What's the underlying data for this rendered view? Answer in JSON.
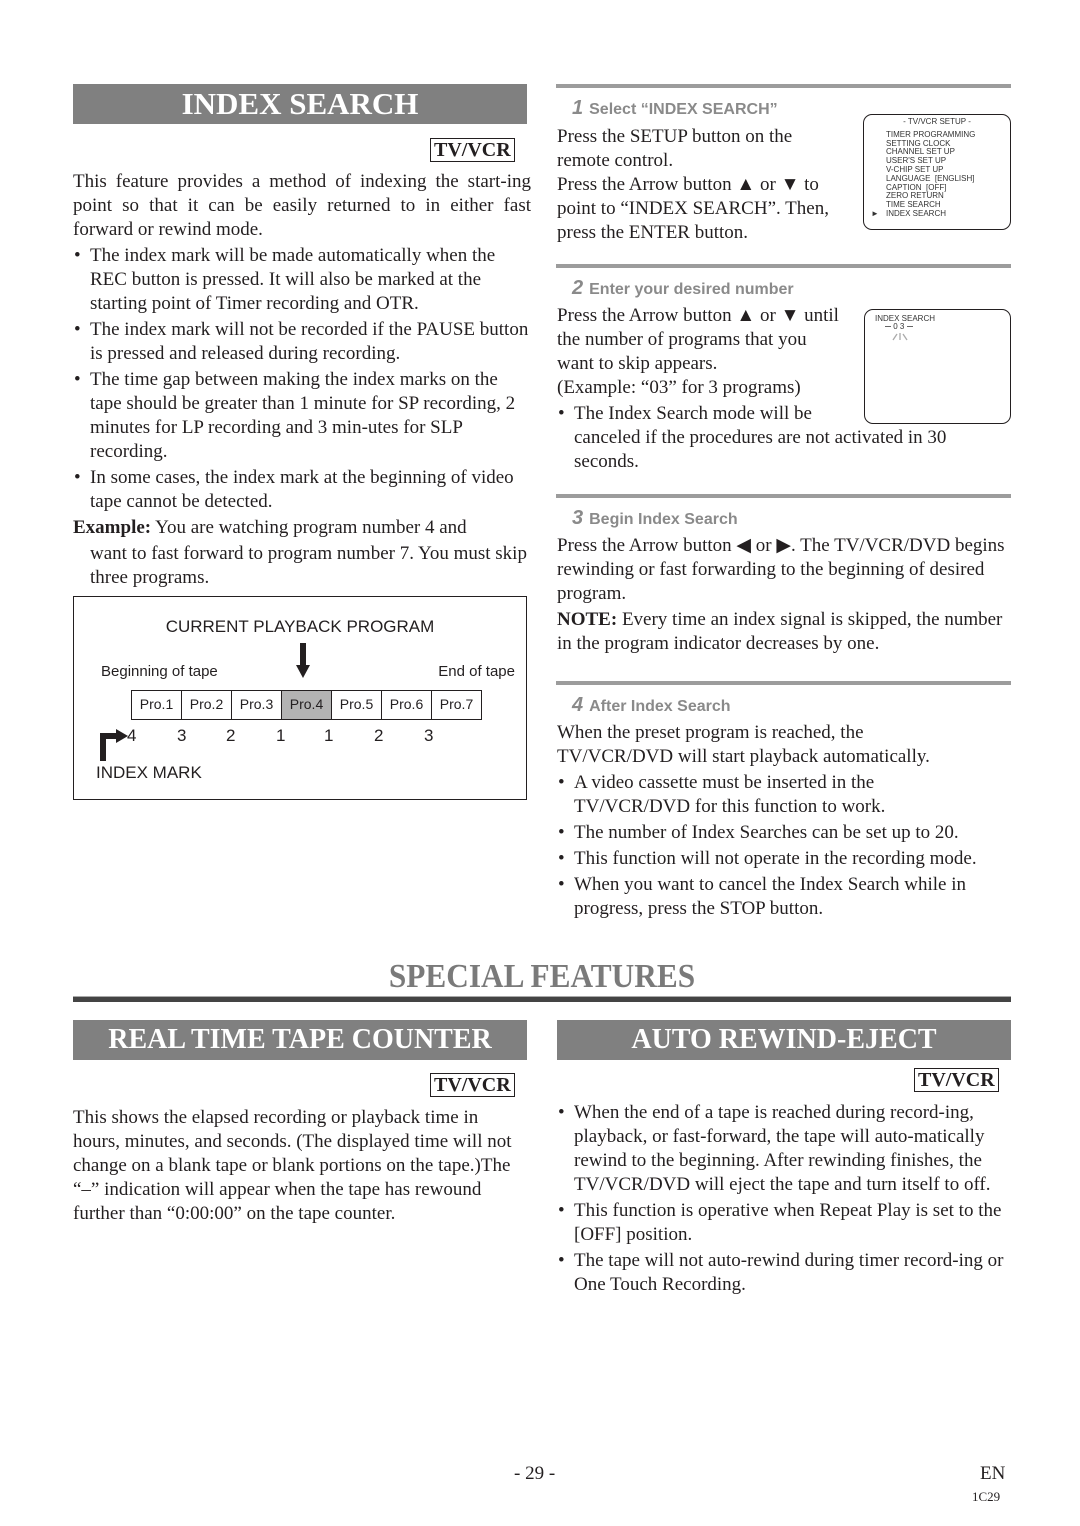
{
  "index_search": {
    "title": "INDEX SEARCH",
    "badge": "TV/VCR",
    "intro": "This feature provides a method of indexing the start-ing point so that it can be easily returned to in either fast forward or rewind mode.",
    "bullets": [
      "The index mark will be made automatically when the REC button is pressed. It will also be marked at the starting point of Timer recording and OTR.",
      "The index mark will not be recorded if the PAUSE button is pressed and released during recording.",
      "The time gap between making the index marks on the tape should be greater than 1 minute for SP recording, 2 minutes for LP recording and 3 min-utes for SLP recording.",
      "In some cases, the index mark at the beginning of video tape cannot be detected."
    ],
    "example_label": "Example:",
    "example_text_line1": "You are watching program number 4 and",
    "example_text_rest": "want to fast forward to program number 7. You must skip three programs.",
    "diagram": {
      "title": "CURRENT PLAYBACK PROGRAM",
      "left_label": "Beginning of tape",
      "right_label": "End of tape",
      "programs": [
        "Pro.1",
        "Pro.2",
        "Pro.3",
        "Pro.4",
        "Pro.5",
        "Pro.6",
        "Pro.7"
      ],
      "current_index": 3,
      "marks": [
        "4",
        "3",
        "2",
        "1",
        "1",
        "2",
        "3"
      ],
      "index_mark_label": "INDEX MARK"
    }
  },
  "steps": [
    {
      "num": "1",
      "title": "Select “INDEX SEARCH”",
      "lines": [
        "Press the SETUP button on the",
        "remote control.",
        "Press the Arrow button ▲ or ▼ to",
        "point to “INDEX SEARCH”. Then,",
        "press the ENTER button."
      ],
      "osd": {
        "header": "- TV/VCR SETUP -",
        "items": [
          "TIMER PROGRAMMING",
          "SETTING CLOCK",
          "CHANNEL SET UP",
          "USER'S SET UP",
          "V-CHIP SET UP",
          "LANGUAGE  [ENGLISH]",
          "CAPTION  [OFF]",
          "ZERO RETURN",
          "TIME SEARCH",
          "INDEX SEARCH"
        ],
        "selected_index": 9,
        "cursor": "►"
      }
    },
    {
      "num": "2",
      "title": "Enter your desired number",
      "lines": [
        "Press the Arrow button ▲ or ▼ until",
        "the number of programs that you",
        "want to skip appears.",
        "(Example: “03” for 3 programs)"
      ],
      "bullet_line1": "The Index Search mode will be",
      "bullet_rest": "canceled if the procedures are not activated in 30 seconds.",
      "osd": {
        "label": "INDEX SEARCH",
        "value": "0 3"
      }
    },
    {
      "num": "3",
      "title": "Begin Index Search",
      "text": "Press the Arrow button ◀ or ▶. The TV/VCR/DVD begins rewinding or fast forwarding to the beginning of desired program.",
      "note_label": "NOTE:",
      "note_text": "Every time an index signal is skipped, the number in the program indicator decreases by one."
    },
    {
      "num": "4",
      "title": "After Index Search",
      "text": "When the preset program is reached, the TV/VCR/DVD will start playback automatically.",
      "bullets": [
        "A video cassette must be inserted in the TV/VCR/DVD for this function to work.",
        "The number of Index Searches can be set up to 20.",
        "This function will not operate in the recording mode.",
        "When you want to cancel the Index Search while in progress, press the STOP button."
      ]
    }
  ],
  "special_features": {
    "title": "SPECIAL FEATURES",
    "tape_counter": {
      "title": "REAL TIME TAPE COUNTER",
      "badge": "TV/VCR",
      "text": "This shows the elapsed recording or playback time in hours, minutes, and seconds. (The displayed time will not change on a blank tape or blank portions on the tape.)The “–” indication will appear when the tape has rewound further than “0:00:00” on the tape counter."
    },
    "auto_rewind": {
      "title": "AUTO REWIND-EJECT",
      "badge": "TV/VCR",
      "bullets": [
        "When the end of a tape is reached during record-ing, playback, or fast-forward, the tape will auto-matically rewind to the beginning. After rewinding finishes, the TV/VCR/DVD will eject the tape and turn itself to off.",
        "This function is operative when Repeat Play is set to the [OFF] position.",
        "The tape will not auto-rewind during timer record-ing or One Touch Recording."
      ]
    }
  },
  "footer": {
    "page_number": "- 29 -",
    "lang": "EN",
    "code": "1C29"
  },
  "bullet_glyph": "•"
}
